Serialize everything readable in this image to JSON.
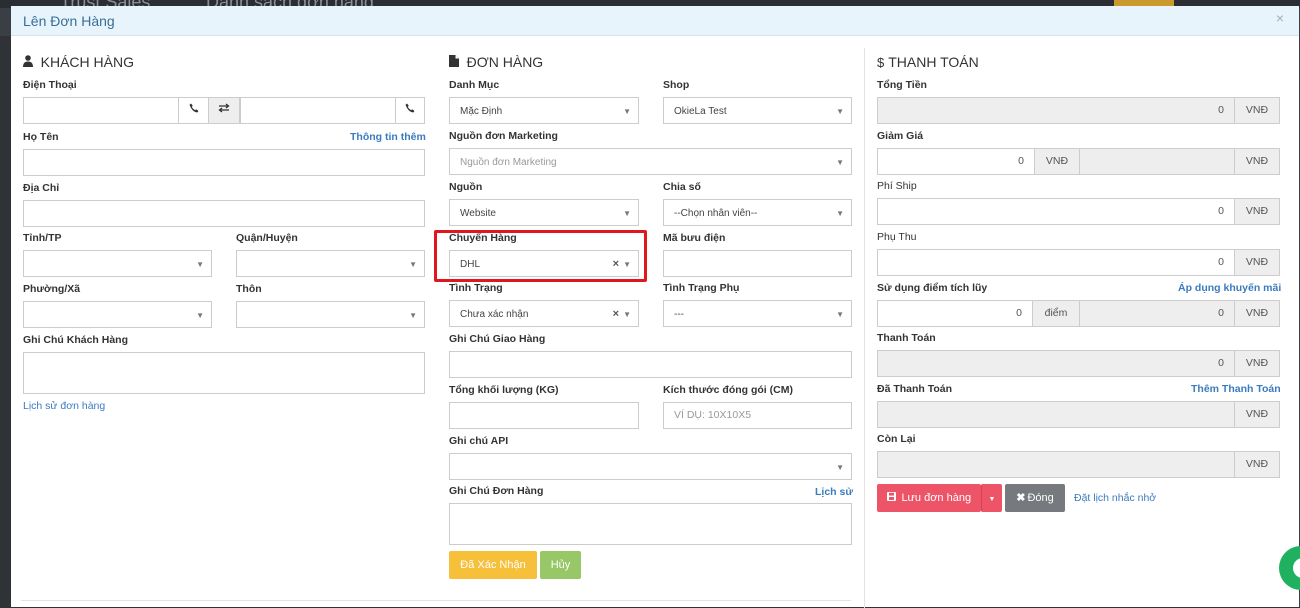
{
  "background": {
    "app_name": "Trust Sales",
    "page_name": "Danh sách đơn hàng"
  },
  "modal": {
    "title": "Lên Đơn Hàng",
    "close": "×"
  },
  "customer": {
    "section_title": "KHÁCH HÀNG",
    "phone_label": "Điện Thoại",
    "name_label": "Họ Tên",
    "more_info_link": "Thông tin thêm",
    "address_label": "Địa Chỉ",
    "province_label": "Tỉnh/TP",
    "district_label": "Quận/Huyện",
    "ward_label": "Phường/Xã",
    "village_label": "Thôn",
    "note_label": "Ghi Chú Khách Hàng",
    "history_link": "Lịch sử đơn hàng"
  },
  "order": {
    "section_title": "ĐƠN HÀNG",
    "category_label": "Danh Mục",
    "category_value": "Mặc Định",
    "shop_label": "Shop",
    "shop_value": "OkieLa Test",
    "marketing_label": "Nguồn đơn Marketing",
    "marketing_placeholder": "Nguồn đơn Marketing",
    "source_label": "Nguồn",
    "source_value": "Website",
    "assign_label": "Chia số",
    "assign_value": "--Chọn nhân viên--",
    "shipping_label": "Chuyển Hàng",
    "shipping_value": "DHL",
    "postal_label": "Mã bưu điện",
    "status_label": "Tình Trạng",
    "status_value": "Chưa xác nhận",
    "substatus_label": "Tình Trạng Phụ",
    "substatus_value": "---",
    "delivery_note_label": "Ghi Chú Giao Hàng",
    "weight_label": "Tổng khối lượng (KG)",
    "package_label": "Kích thước đóng gói (CM)",
    "package_placeholder": "VÍ DỤ: 10X10X5",
    "api_note_label": "Ghi chú API",
    "order_note_label": "Ghi Chú Đơn Hàng",
    "order_history_link": "Lịch sử",
    "confirm_button": "Đã Xác Nhận",
    "cancel_button": "Hủy"
  },
  "payment": {
    "section_title": "THANH TOÁN",
    "total_label": "Tổng Tiền",
    "total_value": "0",
    "currency": "VNĐ",
    "discount_label": "Giảm Giá",
    "discount_value": "0",
    "ship_label": "Phí Ship",
    "ship_value": "0",
    "surcharge_label": "Phụ Thu",
    "surcharge_value": "0",
    "points_label": "Sử dụng điểm tích lũy",
    "promo_link": "Áp dụng khuyến mãi",
    "points_value": "0",
    "points_unit": "điểm",
    "points_money": "0",
    "pay_label": "Thanh Toán",
    "pay_value": "0",
    "paid_label": "Đã Thanh Toán",
    "add_payment_link": "Thêm Thanh Toán",
    "remaining_label": "Còn Lại",
    "save_button": "Lưu đơn hàng",
    "close_button": "Đóng",
    "reminder_link": "Đặt lịch nhắc nhở"
  },
  "colors": {
    "highlight": "#e0171e",
    "link": "#3b7bbf",
    "save": "#ee5467",
    "confirm": "#f7c03a",
    "cancel": "#98c767"
  }
}
